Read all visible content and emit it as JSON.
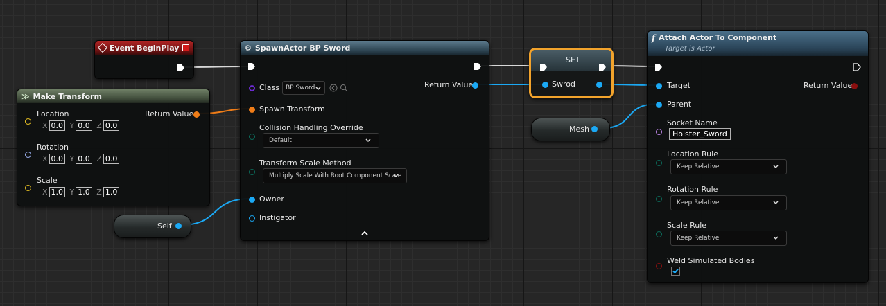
{
  "colors": {
    "exec": "#ffffff",
    "transform": "#f07d18",
    "object": "#1ba9f5",
    "class": "#6b2bd1",
    "rotator": "#9fb5f7",
    "vector": "#f0c823",
    "enum": "#0b6e5d",
    "name": "#c88cf5",
    "bool": "#8a0f0f",
    "selection": "#f2a32c"
  },
  "event_node": {
    "title": "Event BeginPlay",
    "icon": "event-diamond-icon"
  },
  "make_transform": {
    "title": "Make Transform",
    "return_label": "Return Value",
    "location": {
      "label": "Location",
      "x": "0.0",
      "y": "0.0",
      "z": "0.0"
    },
    "rotation": {
      "label": "Rotation",
      "x": "0.0",
      "y": "0.0",
      "z": "0.0"
    },
    "scale": {
      "label": "Scale",
      "x": "1.0",
      "y": "1.0",
      "z": "1.0"
    },
    "axis_x": "X",
    "axis_y": "Y",
    "axis_z": "Z"
  },
  "self_node": {
    "label": "Self"
  },
  "spawn_actor": {
    "title": "SpawnActor BP Sword",
    "class_label": "Class",
    "class_value": "BP Sword",
    "return_label": "Return Value",
    "spawn_transform_label": "Spawn Transform",
    "collision_label": "Collision Handling Override",
    "collision_value": "Default",
    "scale_method_label": "Transform Scale Method",
    "scale_method_value": "Multiply Scale With Root Component Scale",
    "owner_label": "Owner",
    "instigator_label": "Instigator"
  },
  "set_node": {
    "title": "SET",
    "var_label": "Swrod"
  },
  "mesh_node": {
    "label": "Mesh"
  },
  "attach": {
    "title": "Attach Actor To Component",
    "subtitle": "Target is Actor",
    "target_label": "Target",
    "return_label": "Return Value",
    "parent_label": "Parent",
    "socket_label": "Socket Name",
    "socket_value": "Holster_Sword",
    "location_rule_label": "Location Rule",
    "location_rule_value": "Keep Relative",
    "rotation_rule_label": "Rotation Rule",
    "rotation_rule_value": "Keep Relative",
    "scale_rule_label": "Scale Rule",
    "scale_rule_value": "Keep Relative",
    "weld_label": "Weld Simulated Bodies",
    "weld_checked": true
  }
}
